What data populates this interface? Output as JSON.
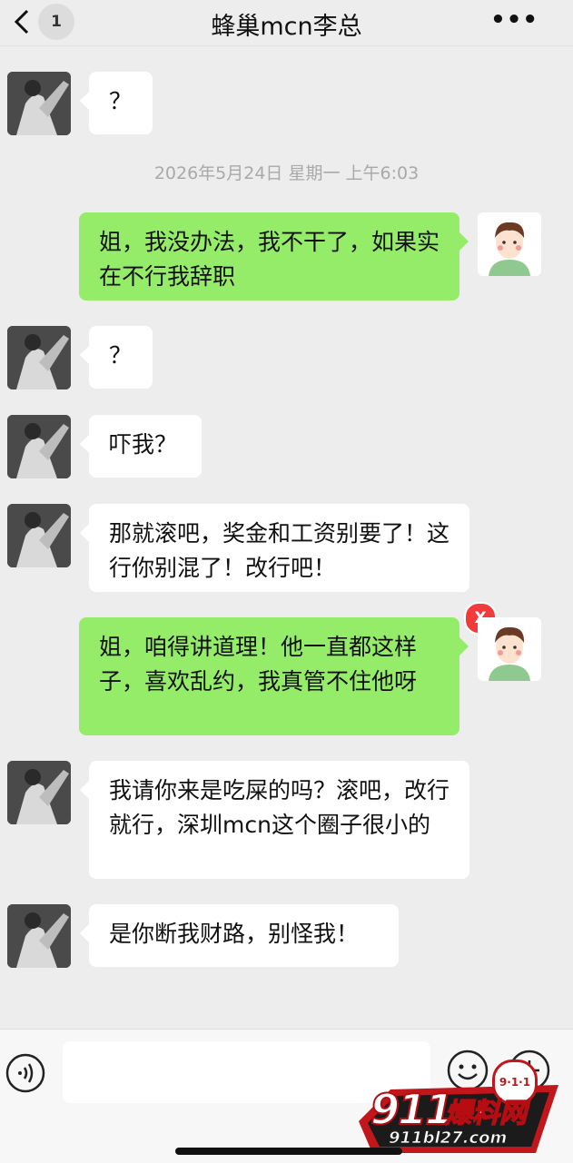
{
  "header": {
    "back_icon": "chevron-left-icon",
    "unread_count": "1",
    "title": "蜂巢mcn李总",
    "more_icon": "more-dots-icon"
  },
  "timestamp": "2026年5月24日 星期一 上午6:03",
  "messages": [
    {
      "sender": "friend",
      "text": "？"
    },
    {
      "sender": "me",
      "text": "姐，我没办法，我不干了，如果实在不行我辞职"
    },
    {
      "sender": "friend",
      "text": "？"
    },
    {
      "sender": "friend",
      "text": "吓我？"
    },
    {
      "sender": "friend",
      "text": "那就滚吧，奖金和工资别要了！这行你别混了！改行吧！"
    },
    {
      "sender": "me",
      "text": "姐，咱得讲道理！他一直都这样子，喜欢乱约，我真管不住他呀",
      "failed": true,
      "failed_mark": "X"
    },
    {
      "sender": "friend",
      "text": "我请你来是吃屎的吗？滚吧，改行就行，深圳mcn这个圈子很小的"
    },
    {
      "sender": "friend",
      "text": "是你断我财路，别怪我！"
    }
  ],
  "input_bar": {
    "voice_icon": "voice-icon",
    "emoji_icon": "emoji-icon",
    "plus_icon": "plus-icon",
    "text_value": ""
  },
  "watermark": {
    "number": "911",
    "brand": "爆料网",
    "url": "911bl27.com",
    "badge": "9·1·1"
  },
  "colors": {
    "background": "#ededed",
    "sent_bubble": "#95ec69",
    "received_bubble": "#ffffff",
    "error_badge": "#f23c3c"
  }
}
